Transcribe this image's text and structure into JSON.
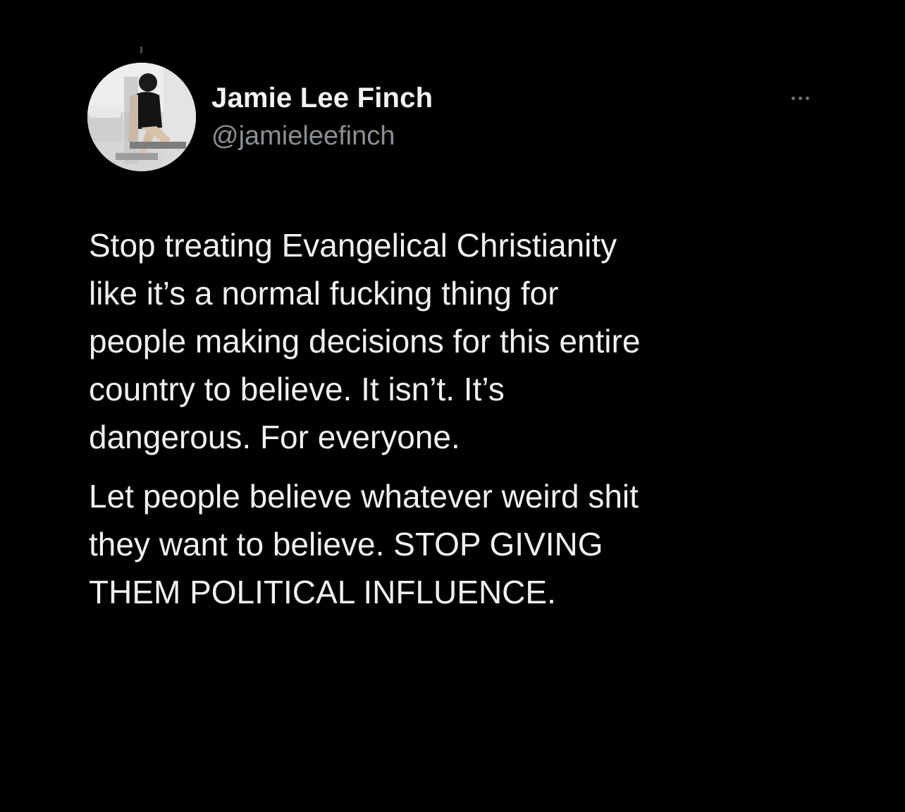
{
  "author": {
    "display_name": "Jamie Lee Finch",
    "handle": "@jamieleefinch",
    "avatar_icon": "profile-photo"
  },
  "menu": {
    "icon": "more-options-icon"
  },
  "tweet": {
    "paragraphs": [
      {
        "lines": [
          "Stop treating Evangelical Christianity",
          "like it’s a normal fucking thing for",
          "people making decisions for this entire",
          "country to believe. It isn’t. It’s",
          "dangerous. For everyone."
        ]
      },
      {
        "lines": [
          "Let people believe whatever weird shit",
          "they want to believe. STOP GIVING",
          "THEM POLITICAL INFLUENCE."
        ]
      }
    ]
  },
  "colors": {
    "background": "#000000",
    "text": "#f0f0f0",
    "secondary_text": "#8b9095"
  }
}
